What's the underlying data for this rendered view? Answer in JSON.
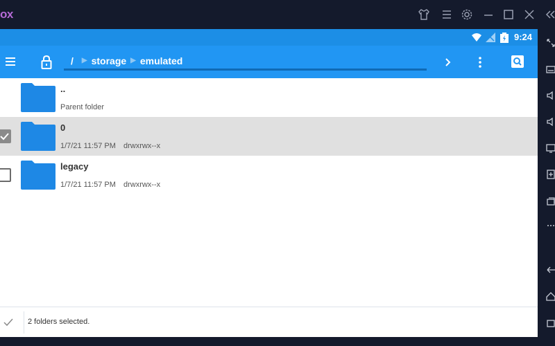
{
  "titlebar": {
    "logo_text": "ox",
    "icons": [
      "shirt-icon",
      "menu-icon",
      "settings-icon",
      "minimize-icon",
      "maximize-icon",
      "close-icon",
      "collapse-icon"
    ]
  },
  "statusbar": {
    "time": "9:24",
    "icons": [
      "wifi-icon",
      "signal-icon",
      "battery-icon"
    ]
  },
  "toolbar": {
    "breadcrumb": {
      "root": "/",
      "items": [
        "storage",
        "emulated"
      ]
    },
    "buttons": [
      "menu-icon",
      "lock-icon",
      "forward-icon",
      "more-vert-icon",
      "search-icon"
    ]
  },
  "files": [
    {
      "name": "..",
      "meta1": "Parent folder",
      "meta2": "",
      "checkbox": "none",
      "selected": false
    },
    {
      "name": "0",
      "meta1": "1/7/21 11:57 PM",
      "meta2": "drwxrwx--x",
      "checkbox": "checked",
      "selected": true
    },
    {
      "name": "legacy",
      "meta1": "1/7/21 11:57 PM",
      "meta2": "drwxrwx--x",
      "checkbox": "unchecked",
      "selected": false
    }
  ],
  "bottombar": {
    "status": "2 folders selected."
  },
  "colors": {
    "accent": "#2196f3",
    "statusbar": "#1c8ee6",
    "folder": "#1e88e5",
    "frame": "#141a2c",
    "selected_row": "#e0e0e0"
  }
}
